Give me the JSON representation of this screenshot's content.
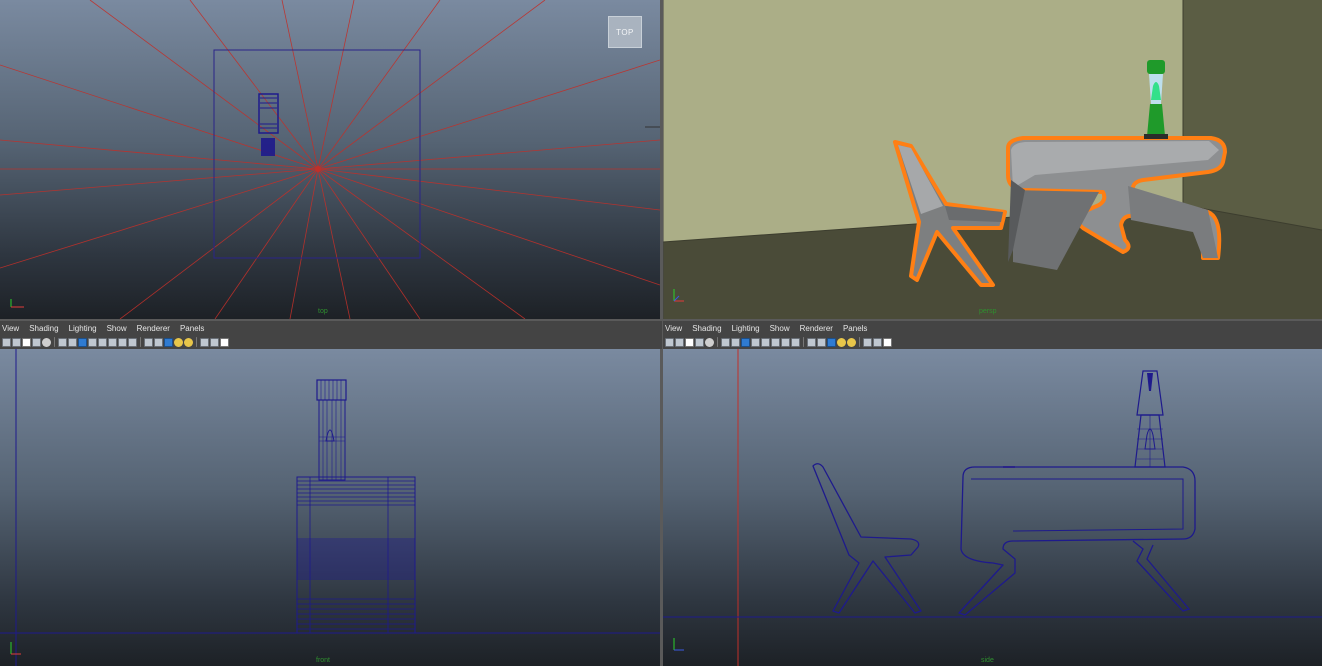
{
  "panels": {
    "top_left": {
      "camera": "top",
      "view_cube_label": "TOP"
    },
    "top_right": {
      "camera": "persp"
    },
    "bottom_left": {
      "camera": "front",
      "menu": [
        "View",
        "Shading",
        "Lighting",
        "Show",
        "Renderer",
        "Panels"
      ]
    },
    "bottom_right": {
      "camera": "side",
      "menu": [
        "View",
        "Shading",
        "Lighting",
        "Show",
        "Renderer",
        "Panels"
      ]
    }
  },
  "toolbar_icons": [
    "camera-icon",
    "camera-attr-icon",
    "bookmark-icon",
    "image-plane-icon",
    "grid-icon",
    "film-gate-icon",
    "resolution-gate-icon",
    "wireframe-icon",
    "smooth-shade-icon",
    "textured-icon",
    "lights-icon",
    "shadows-icon",
    "isolate-icon",
    "xray-icon",
    "xray-joints-icon",
    "default-light-icon",
    "all-lights-icon",
    "isolate-select-icon",
    "highlight-icon",
    "panel-layout-icon"
  ],
  "colors": {
    "viewport_top": "#7a8aa0",
    "viewport_bottom": "#1d2126",
    "wireframe": "#1e1a8c",
    "selection_orange": "#ff7f14",
    "grid_red": "#c0302a",
    "lava_green": "#1f9a2a"
  }
}
